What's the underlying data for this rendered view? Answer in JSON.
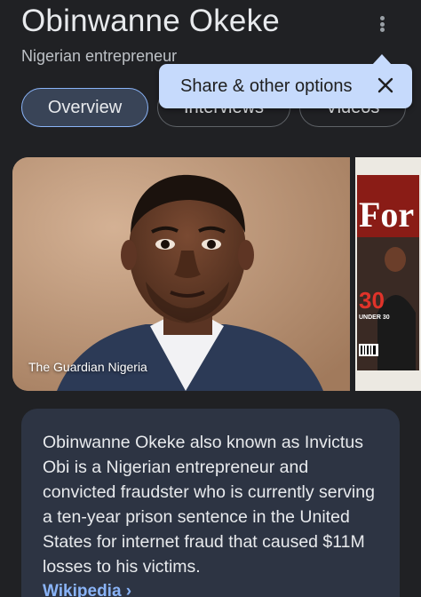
{
  "entity": {
    "title": "Obinwanne Okeke",
    "subtitle": "Nigerian entrepreneur"
  },
  "tabs": [
    {
      "label": "Overview",
      "active": true
    },
    {
      "label": "Interviews",
      "active": false
    },
    {
      "label": "Videos",
      "active": false
    }
  ],
  "tooltip": {
    "text": "Share & other options",
    "close_icon": "close-icon"
  },
  "images": {
    "main_caption": "The Guardian Nigeria",
    "secondary": {
      "masthead": "For",
      "badge_number": "30",
      "badge_text": "UNDER 30"
    }
  },
  "description": {
    "text": "Obinwanne Okeke also known as Invictus Obi is a Nigerian entrepreneur and convicted fraudster who is currently serving a ten-year prison sentence in the United States for internet fraud that caused $11M losses to his victims.",
    "source_link": "Wikipedia ›"
  },
  "colors": {
    "background": "#202124",
    "tooltip_bg": "#c6dafc",
    "link": "#8ab4f8",
    "active_tab_bg": "#394457",
    "card_bg": "#2d3443"
  }
}
